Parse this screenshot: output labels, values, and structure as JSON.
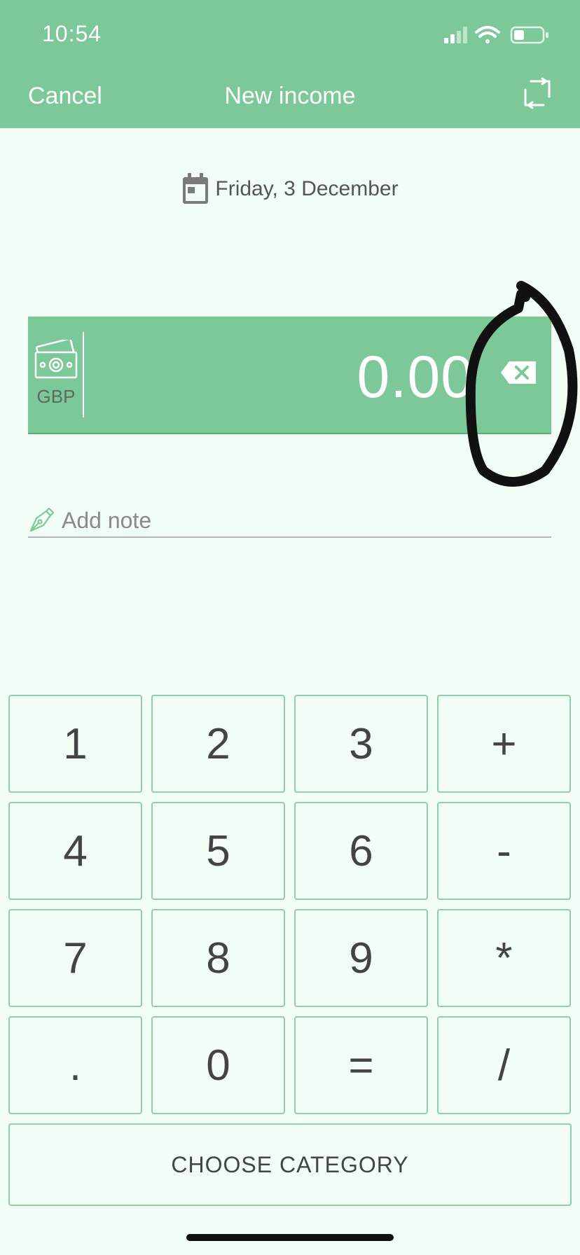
{
  "status_bar": {
    "time": "10:54",
    "icons": [
      "cellular-signal-icon",
      "wifi-icon",
      "battery-icon"
    ]
  },
  "header": {
    "cancel_label": "Cancel",
    "title": "New income",
    "swap_icon": "swap-icon"
  },
  "date": {
    "icon": "calendar-icon",
    "label": "Friday, 3 December"
  },
  "amount": {
    "currency_icon": "banknotes-icon",
    "currency_code": "GBP",
    "value": "0.00",
    "backspace_icon": "backspace-icon"
  },
  "note": {
    "icon": "pen-icon",
    "placeholder": "Add note",
    "value": ""
  },
  "keypad": {
    "keys": [
      "1",
      "2",
      "3",
      "+",
      "4",
      "5",
      "6",
      "-",
      "7",
      "8",
      "9",
      "*",
      ".",
      "0",
      "=",
      "/"
    ]
  },
  "choose_category_label": "CHOOSE CATEGORY",
  "colors": {
    "header_bg": "#7cc898",
    "page_bg": "#f2fdf5",
    "key_border": "#8fcfa6",
    "text": "#444444"
  }
}
